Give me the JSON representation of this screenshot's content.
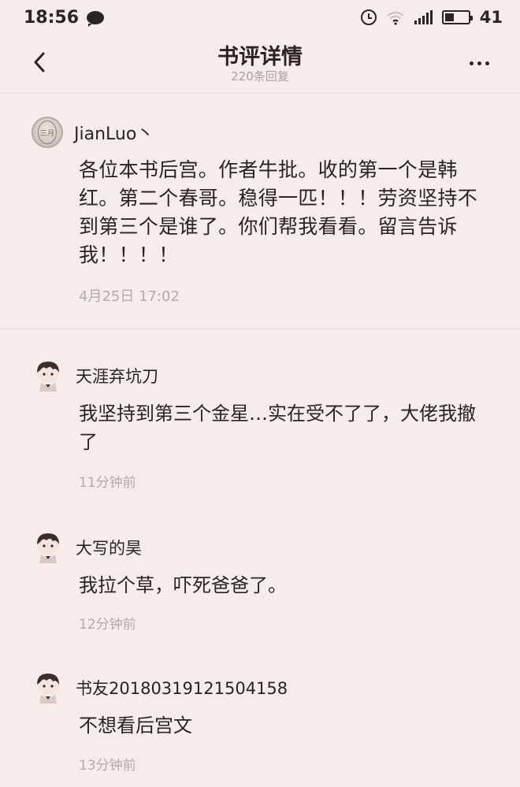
{
  "status_bar": {
    "time": "18:56",
    "battery": "41"
  },
  "header": {
    "title": "书评详情",
    "subtitle": "220条回复"
  },
  "main_comment": {
    "author": "JianLuo丶",
    "avatar_badge_text": "三月",
    "text": "各位本书后宫。作者牛批。收的第一个是韩红。第二个春哥。稳得一匹！！！劳资坚持不到第三个是谁了。你们帮我看看。留言告诉我！！！！",
    "time": "4月25日 17:02"
  },
  "replies": [
    {
      "author": "天涯弃坑刀",
      "text": "我坚持到第三个金星…实在受不了了，大佬我撤了",
      "time": "11分钟前"
    },
    {
      "author": "大写的昊",
      "text": "我拉个草，吓死爸爸了。",
      "time": "12分钟前"
    },
    {
      "author": "书友20180319121504158",
      "text": "不想看后宫文",
      "time": "13分钟前"
    }
  ],
  "icons": {
    "back": "back-arrow-icon",
    "more": "more-icon",
    "alarm": "alarm-icon",
    "wifi": "wifi-icon",
    "signal": "signal-icon",
    "battery": "battery-icon",
    "chat": "chat-bubble-icon"
  },
  "colors": {
    "background": "#f7ecea",
    "text": "#2a2324",
    "muted": "#b3aaaa"
  }
}
